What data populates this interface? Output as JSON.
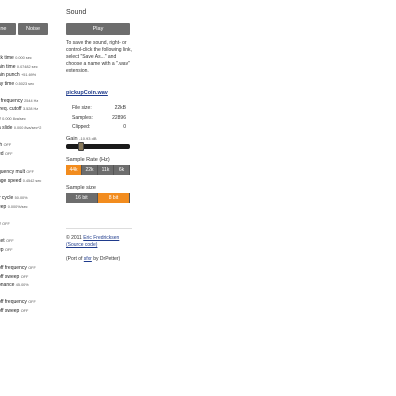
{
  "left": {
    "wave_buttons": [
      "Sine",
      "Noise"
    ],
    "params": [
      {
        "label": "ck time",
        "value": "0.000 sec"
      },
      {
        "label": "ain time",
        "value": "0.07482 sec"
      },
      {
        "label": "ain punch",
        "value": "+51.69%"
      },
      {
        "label": "ay time",
        "value": "0.5023 sec"
      },
      {
        "label": "t frequency",
        "value": "2544 Hz"
      },
      {
        "label": "freq. cutoff",
        "value": "3.528 Hz"
      },
      {
        "label": "e",
        "value": "0.000 8va/sec"
      },
      {
        "label": "a slide",
        "value": "0.000 8va/sec^2"
      },
      {
        "label": "th",
        "value": "OFF"
      },
      {
        "label": "ed",
        "value": "OFF"
      },
      {
        "label": "quency mult",
        "value": "OFF"
      },
      {
        "label": "nge speed",
        "value": "0.4542 sec"
      },
      {
        "label": "y cycle",
        "value": "50.00%"
      },
      {
        "label": "eep",
        "value": "0.000%/sec"
      },
      {
        "label": "e",
        "value": "OFF"
      },
      {
        "label": "set",
        "value": "OFF"
      },
      {
        "label": "ep",
        "value": "OFF"
      },
      {
        "label": "off frequency",
        "value": "OFF"
      },
      {
        "label": "off sweep",
        "value": "OFF"
      },
      {
        "label": "onance",
        "value": "45.00%"
      },
      {
        "label": "off frequency",
        "value": "OFF"
      },
      {
        "label": "off sweep",
        "value": "OFF"
      }
    ]
  },
  "panel": {
    "heading": "Sound",
    "play_label": "Play",
    "save_text": "To save the sound, right- or control-click the following link, select \"Save As...\" and choose a name with a \".wav\" extension.",
    "file_link": "pickupCoin.wav",
    "stats": [
      {
        "label": "File size:",
        "value": "22kB"
      },
      {
        "label": "Samples:",
        "value": "22896"
      },
      {
        "label": "Clipped:",
        "value": "0"
      }
    ],
    "gain_label": "Gain",
    "gain_value": "-10.93 dB",
    "gain_level": 0.2,
    "sample_rate_label": "Sample Rate (Hz)",
    "sample_rates": [
      "44k",
      "22k",
      "11k",
      "6k"
    ],
    "sample_rate_selected": "44k",
    "sample_size_label": "Sample size",
    "sample_sizes": [
      "16 bit",
      "8 bit"
    ],
    "sample_size_selected": "8 bit",
    "copyright_prefix": "© 2011",
    "copyright_author": "Eric Fredricksen",
    "source_link": "(Source code)",
    "port_prefix": "(Port of",
    "port_link": "sfxr",
    "port_suffix": "by DrPetter)"
  },
  "colors": {
    "button_bg": "#6d6d6d",
    "accent": "#f28c1e",
    "link": "#1f3b8c"
  }
}
